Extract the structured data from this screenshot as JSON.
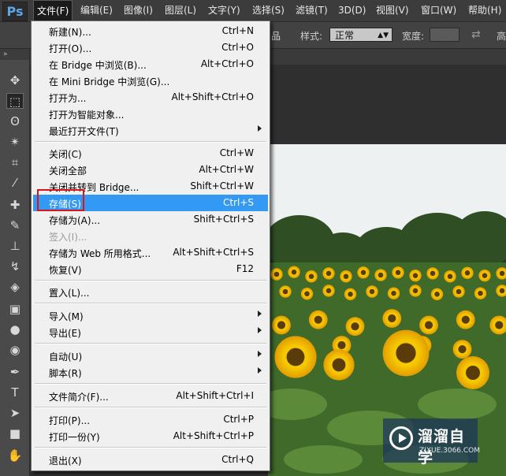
{
  "app": {
    "logo": "Ps"
  },
  "menubar": [
    "文件(F)",
    "编辑(E)",
    "图像(I)",
    "图层(L)",
    "文字(Y)",
    "选择(S)",
    "滤镜(T)",
    "3D(D)",
    "视图(V)",
    "窗口(W)",
    "帮助(H)"
  ],
  "options": {
    "partial_label": "品",
    "style_label": "样式:",
    "style_value": "正常",
    "width_label": "宽度:",
    "height_partial": "高"
  },
  "toolbar": {
    "grip": "»"
  },
  "file_menu": {
    "items": [
      {
        "label": "新建(N)...",
        "shortcut": "Ctrl+N"
      },
      {
        "label": "打开(O)...",
        "shortcut": "Ctrl+O"
      },
      {
        "label": "在 Bridge 中浏览(B)...",
        "shortcut": "Alt+Ctrl+O"
      },
      {
        "label": "在 Mini Bridge 中浏览(G)...",
        "shortcut": ""
      },
      {
        "label": "打开为...",
        "shortcut": "Alt+Shift+Ctrl+O"
      },
      {
        "label": "打开为智能对象...",
        "shortcut": ""
      },
      {
        "label": "最近打开文件(T)",
        "shortcut": ""
      },
      {
        "label": "关闭(C)",
        "shortcut": "Ctrl+W"
      },
      {
        "label": "关闭全部",
        "shortcut": "Alt+Ctrl+W"
      },
      {
        "label": "关闭并转到 Bridge...",
        "shortcut": "Shift+Ctrl+W"
      },
      {
        "label": "存储(S)",
        "shortcut": "Ctrl+S"
      },
      {
        "label": "存储为(A)...",
        "shortcut": "Shift+Ctrl+S"
      },
      {
        "label": "签入(I)...",
        "shortcut": ""
      },
      {
        "label": "存储为 Web 所用格式...",
        "shortcut": "Alt+Shift+Ctrl+S"
      },
      {
        "label": "恢复(V)",
        "shortcut": "F12"
      },
      {
        "label": "置入(L)...",
        "shortcut": ""
      },
      {
        "label": "导入(M)",
        "shortcut": ""
      },
      {
        "label": "导出(E)",
        "shortcut": ""
      },
      {
        "label": "自动(U)",
        "shortcut": ""
      },
      {
        "label": "脚本(R)",
        "shortcut": ""
      },
      {
        "label": "文件简介(F)...",
        "shortcut": "Alt+Shift+Ctrl+I"
      },
      {
        "label": "打印(P)...",
        "shortcut": "Ctrl+P"
      },
      {
        "label": "打印一份(Y)",
        "shortcut": "Alt+Shift+Ctrl+P"
      },
      {
        "label": "退出(X)",
        "shortcut": "Ctrl+Q"
      }
    ]
  },
  "watermark": {
    "title": "溜溜自学",
    "url": "ZIXUE.3066.COM"
  }
}
